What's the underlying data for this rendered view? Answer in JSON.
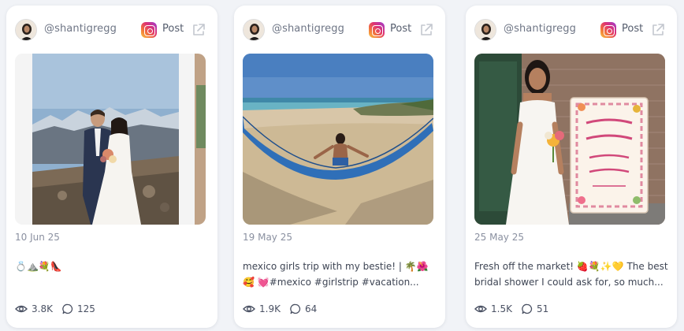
{
  "colors": {
    "page_bg": "#f1f3f7",
    "card_bg": "#ffffff",
    "handle_text": "#6e7585",
    "date_text": "#8a90a0"
  },
  "cards": [
    {
      "handle": "@shantigregg",
      "platform_icon": "instagram-icon",
      "post_label": "Post",
      "open_icon": "external-link-icon",
      "image_subject": "wedding couple on mountain top",
      "date": "10 Jun 25",
      "caption": "💍⛰️💐👠",
      "views": "3.8K",
      "comments": "125"
    },
    {
      "handle": "@shantigregg",
      "platform_icon": "instagram-icon",
      "post_label": "Post",
      "open_icon": "external-link-icon",
      "image_subject": "woman in blue hammock on beach",
      "date": "19 May 25",
      "caption": "mexico girls trip with my bestie! | 🌴🌺🥰 💓#mexico #girlstrip #vacation...",
      "views": "1.9K",
      "comments": "64"
    },
    {
      "handle": "@shantigregg",
      "platform_icon": "instagram-icon",
      "post_label": "Post",
      "open_icon": "external-link-icon",
      "image_subject": "woman in white dress with bridal shower sign",
      "date": "25 May 25",
      "caption": "Fresh off the market! 🍓💐✨💛 The best bridal shower I could ask for, so much...",
      "views": "1.5K",
      "comments": "51"
    }
  ]
}
